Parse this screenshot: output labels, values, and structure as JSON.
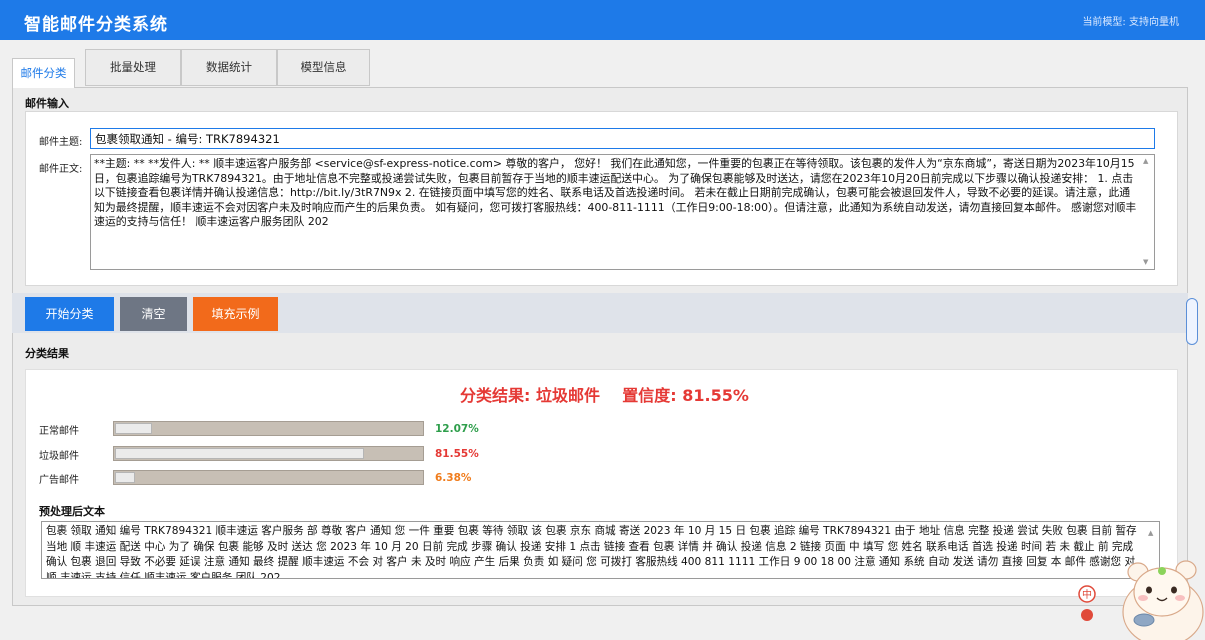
{
  "header": {
    "app_title": "智能邮件分类系统",
    "model_label": "当前模型: 支持向量机"
  },
  "tabs": [
    {
      "label": "邮件分类",
      "active": true
    },
    {
      "label": "批量处理",
      "active": false
    },
    {
      "label": "数据统计",
      "active": false
    },
    {
      "label": "模型信息",
      "active": false
    }
  ],
  "input_section": {
    "title": "邮件输入",
    "subject_label": "邮件主题:",
    "subject_value": "包裹领取通知 - 编号: TRK7894321",
    "body_label": "邮件正文:",
    "body_value": "**主题: ** **发件人: ** 顺丰速运客户服务部 <service@sf-express-notice.com> 尊敬的客户， 您好！ 我们在此通知您，一件重要的包裹正在等待领取。该包裹的发件人为“京东商城”，寄送日期为2023年10月15日，包裹追踪编号为TRK7894321。由于地址信息不完整或投递尝试失败，包裹目前暂存于当地的顺丰速运配送中心。 为了确保包裹能够及时送达，请您在2023年10月20日前完成以下步骤以确认投递安排： 1. 点击以下链接查看包裹详情并确认投递信息：http://bit.ly/3tR7N9x 2. 在链接页面中填写您的姓名、联系电话及首选投递时间。 若未在截止日期前完成确认，包裹可能会被退回发件人，导致不必要的延误。请注意，此通知为最终提醒，顺丰速运不会对因客户未及时响应而产生的后果负责。 如有疑问，您可拨打客服热线：400-811-1111（工作日9:00-18:00）。但请注意，此通知为系统自动发送，请勿直接回复本邮件。 感谢您对顺丰速运的支持与信任！ 顺丰速运客户服务团队 202"
  },
  "buttons": {
    "classify": "开始分类",
    "clear": "清空",
    "fill_example": "填充示例"
  },
  "result_section": {
    "title": "分类结果",
    "headline": "分类结果: 垃圾邮件    置信度: 81.55%",
    "categories": [
      {
        "label": "正常邮件",
        "percent_text": "12.07%",
        "value": 0.1207,
        "color": "#2e9e4b"
      },
      {
        "label": "垃圾邮件",
        "percent_text": "81.55%",
        "value": 0.8155,
        "color": "#e53935"
      },
      {
        "label": "广告邮件",
        "percent_text": "6.38%",
        "value": 0.0638,
        "color": "#f07c1c"
      }
    ],
    "preprocessed_title": "预处理后文本",
    "preprocessed_text": "包裹 领取 通知 编号 TRK7894321 顺丰速运 客户服务 部 尊敬 客户 通知 您 一件 重要 包裹 等待 领取 该 包裹 京东 商城 寄送 2023 年 10 月 15 日 包裹 追踪 编号 TRK7894321 由于 地址 信息 完整 投递 尝试 失败 包裹 目前 暂存 当地 顺 丰速运 配送 中心 为了 确保 包裹 能够 及时 送达 您 2023 年 10 月 20 日前 完成 步骤 确认 投递 安排 1 点击 链接 查看 包裹 详情 并 确认 投递 信息 2 链接 页面 中 填写 您 姓名 联系电话 首选 投递 时间 若 未 截止 前 完成 确认 包裹 退回 导致 不必要 延误 注意 通知 最终 提醒 顺丰速运 不会 对 客户 未 及时 响应 产生 后果 负责 如 疑问 您 可拨打 客服热线 400 811 1111 工作日 9 00 18 00 注意 通知 系统 自动 发送 请勿 直接 回复 本 邮件 感谢您 对顺 丰速运 支持 信任 顺丰速运 客户服务 团队 202"
  },
  "colors": {
    "primary": "#1e7ae8",
    "gray_button": "#6e7684",
    "orange_button": "#f26a1b"
  },
  "overlay": {
    "badge": "中"
  }
}
